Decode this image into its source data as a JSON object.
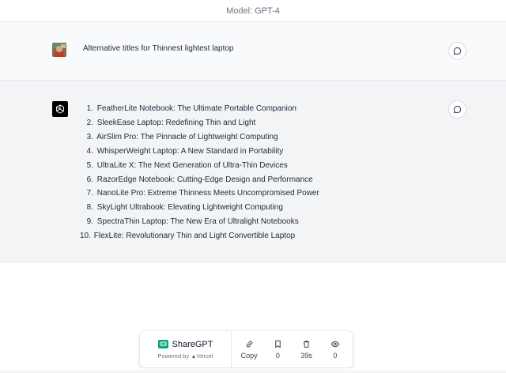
{
  "header": {
    "model_label": "Model: GPT-4"
  },
  "conversation": {
    "user_message": "Alternative titles for Thinnest lightest laptop",
    "assistant_items": [
      {
        "num": "1.",
        "text": "FeatherLite Notebook: The Ultimate Portable Companion"
      },
      {
        "num": "2.",
        "text": "SleekEase Laptop: Redefining Thin and Light"
      },
      {
        "num": "3.",
        "text": "AirSlim Pro: The Pinnacle of Lightweight Computing"
      },
      {
        "num": "4.",
        "text": "WhisperWeight Laptop: A New Standard in Portability"
      },
      {
        "num": "5.",
        "text": "UltraLite X: The Next Generation of Ultra-Thin Devices"
      },
      {
        "num": "6.",
        "text": "RazorEdge Notebook: Cutting-Edge Design and Performance"
      },
      {
        "num": "7.",
        "text": "NanoLite Pro: Extreme Thinness Meets Uncompromised Power"
      },
      {
        "num": "8.",
        "text": "SkyLight Ultrabook: Elevating Lightweight Computing"
      },
      {
        "num": "9.",
        "text": "SpectraThin Laptop: The New Era of Ultralight Notebooks"
      },
      {
        "num": "10.",
        "text": "FlexLite: Revolutionary Thin and Light Convertible Laptop"
      }
    ]
  },
  "footer": {
    "brand_name": "ShareGPT",
    "powered_by": "Powered by ▲Vercel",
    "copy_label": "Copy",
    "bookmarks": "0",
    "deleted_time": "39s",
    "views": "0"
  },
  "colors": {
    "brand_green": "#10a37f",
    "assistant_bg": "#f3f4f6",
    "user_bg": "#f9fafb"
  },
  "icons": [
    "user-avatar",
    "openai-logo-icon",
    "chat-bubble-icon",
    "link-icon",
    "bookmark-icon",
    "trash-icon",
    "eye-icon"
  ]
}
